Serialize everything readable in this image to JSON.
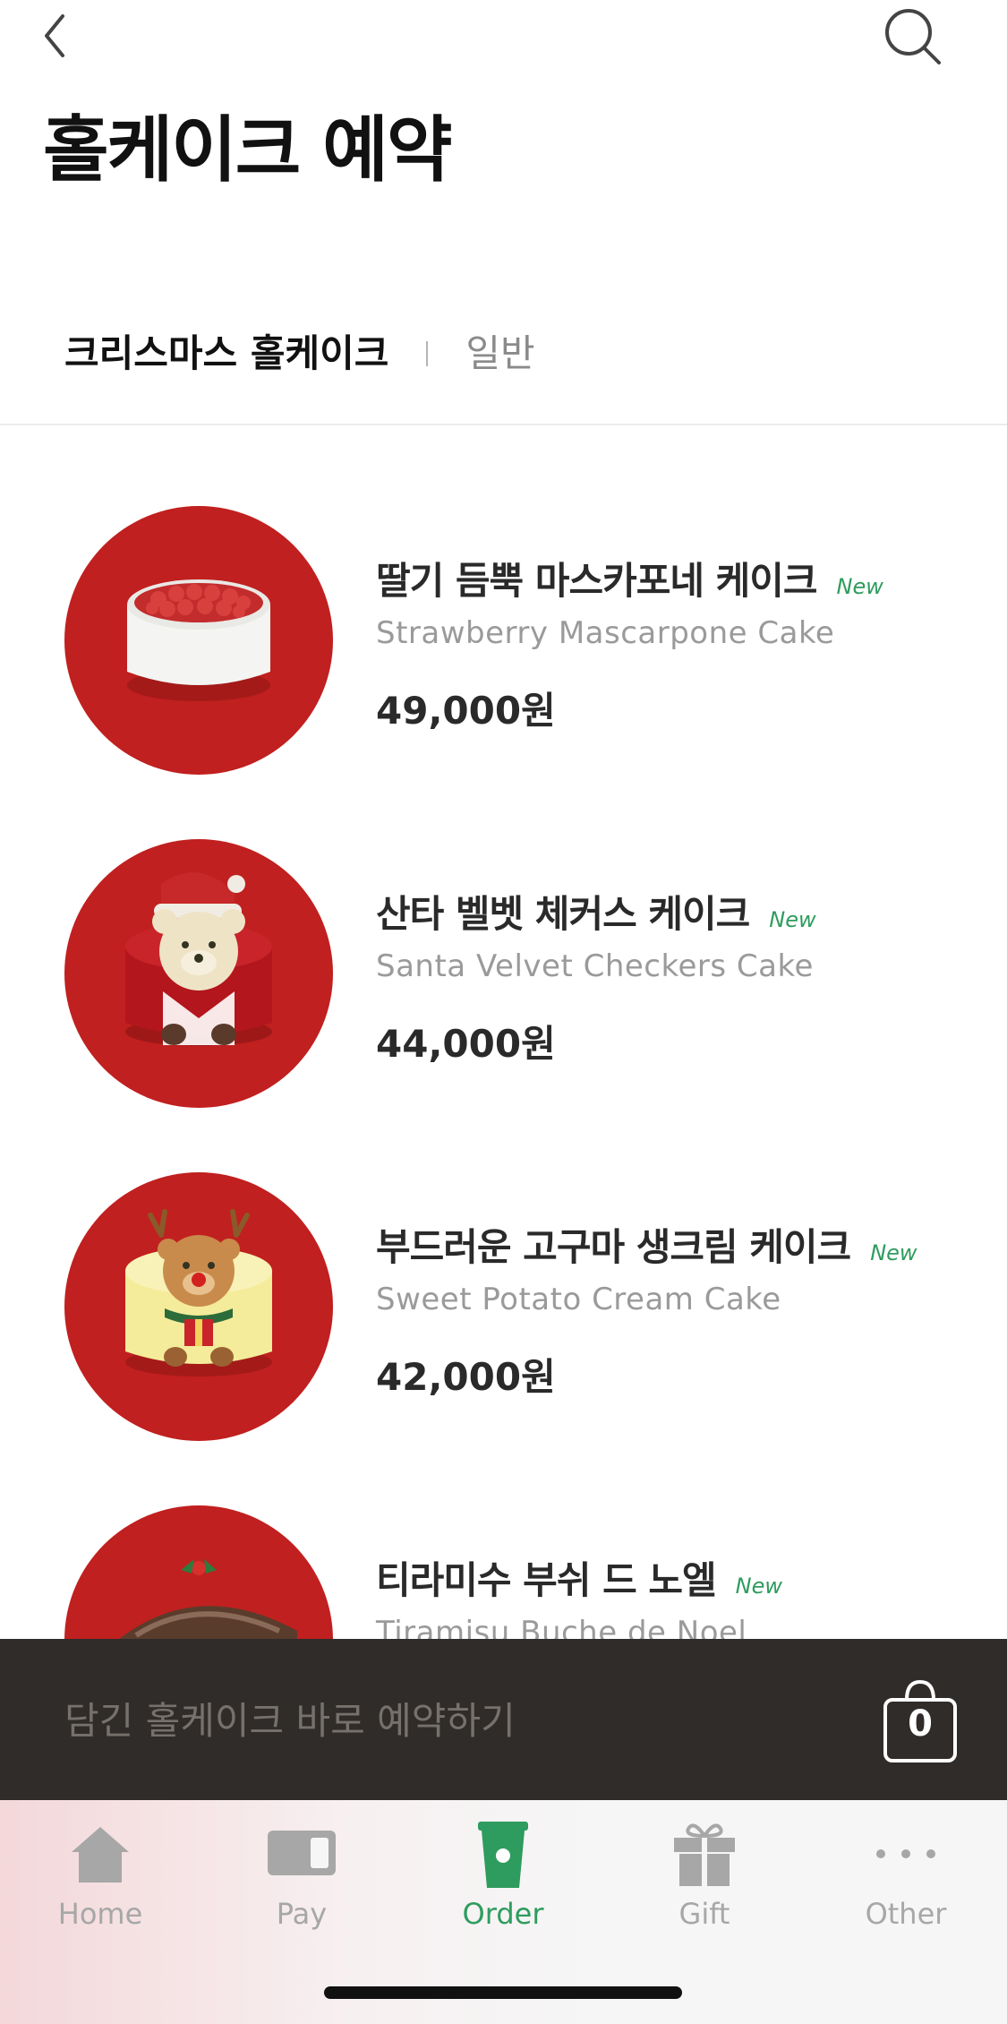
{
  "header": {
    "title": "홀케이크 예약",
    "back_icon": "chevron-left-icon",
    "search_icon": "search-icon"
  },
  "tabs": {
    "active": "크리스마스 홀케이크",
    "inactive": "일반"
  },
  "products": [
    {
      "name_ko": "딸기 듬뿍 마스카포네 케이크",
      "badge": "New",
      "name_en": "Strawberry Mascarpone Cake",
      "price": "49,000원"
    },
    {
      "name_ko": "산타 벨벳 체커스 케이크",
      "badge": "New",
      "name_en": "Santa Velvet Checkers Cake",
      "price": "44,000원"
    },
    {
      "name_ko": "부드러운 고구마 생크림 케이크",
      "badge": "New",
      "name_en": "Sweet Potato Cream Cake",
      "price": "42,000원"
    },
    {
      "name_ko": "티라미수 부쉬 드 노엘",
      "badge": "New",
      "name_en": "Tiramisu Buche de Noel",
      "price": ""
    }
  ],
  "reserve": {
    "label": "담긴 홀케이크 바로 예약하기",
    "cart_count": "0"
  },
  "tabbar": {
    "items": [
      {
        "label": "Home",
        "icon": "home-icon"
      },
      {
        "label": "Pay",
        "icon": "card-icon"
      },
      {
        "label": "Order",
        "icon": "cup-icon"
      },
      {
        "label": "Gift",
        "icon": "gift-icon"
      },
      {
        "label": "Other",
        "icon": "more-icon"
      }
    ],
    "active_index": 2
  },
  "colors": {
    "accent_green": "#2e9c5e",
    "thumb_red": "#c0201f",
    "bar_dark": "#2f2c2a"
  }
}
